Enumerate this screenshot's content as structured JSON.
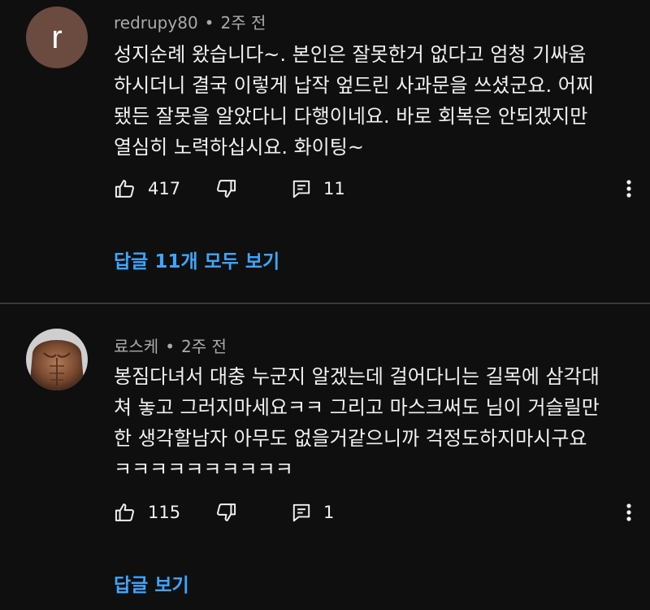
{
  "comments": [
    {
      "author": "redrupy80",
      "separator": "•",
      "time": "2주 전",
      "avatar_letter": "r",
      "text": "성지순례 왔습니다~. 본인은 잘못한거 없다고 엄청 기싸움\n하시더니 결국 이렇게 납작 엎드린 사과문을 쓰셨군요. 어찌\n됐든 잘못을 알았다니 다행이네요. 바로 회복은 안되겠지만\n열심히 노력하십시요. 화이팅~",
      "likes": "417",
      "reply_count": "11",
      "replies_label": "답글 11개 모두 보기"
    },
    {
      "author": "료스케",
      "separator": "•",
      "time": "2주 전",
      "text": "봉짐다녀서 대충 누군지 알겠는데 걸어다니는 길목에 삼각대\n쳐 놓고 그러지마세요ㅋㅋ 그리고 마스크써도 님이 거슬릴만\n한 생각할남자 아무도 없을거같으니까 걱정도하지마시구요\nㅋㅋㅋㅋㅋㅋㅋㅋㅋㅋ",
      "likes": "115",
      "reply_count": "1",
      "replies_label": "답글 보기"
    }
  ],
  "icons": {
    "like": "thumb-up-icon",
    "dislike": "thumb-down-icon",
    "reply": "comment-icon",
    "more": "more-vertical-icon"
  },
  "colors": {
    "background": "#0f0f0f",
    "text": "#f1f1f1",
    "meta": "#aaaaaa",
    "link": "#3ea6ff",
    "avatar_bg": "#6b4a40"
  }
}
